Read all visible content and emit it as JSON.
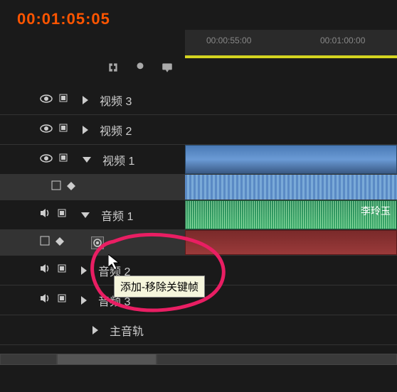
{
  "timecode": "00:01:05:05",
  "ruler": {
    "ticks": [
      "00:00:55:00",
      "00:01:00:00"
    ]
  },
  "tracks": {
    "video3": {
      "label": "视频 3"
    },
    "video2": {
      "label": "视频 2"
    },
    "video1": {
      "label": "视频 1"
    },
    "audio1": {
      "label": "音频 1",
      "clip_label": "李玲玉"
    },
    "audio2": {
      "label": "音频 2"
    },
    "audio3": {
      "label": "音频 3"
    },
    "master": {
      "label": "主音轨"
    }
  },
  "tooltip": "添加-移除关键帧",
  "icons": {
    "eye": "eye-icon",
    "lock": "lock-icon",
    "speaker": "speaker-icon",
    "keyframe": "keyframe-icon"
  },
  "colors": {
    "timecode": "#ff5500",
    "annotation": "#e91e63",
    "tooltip_bg": "#f5f5dc"
  }
}
